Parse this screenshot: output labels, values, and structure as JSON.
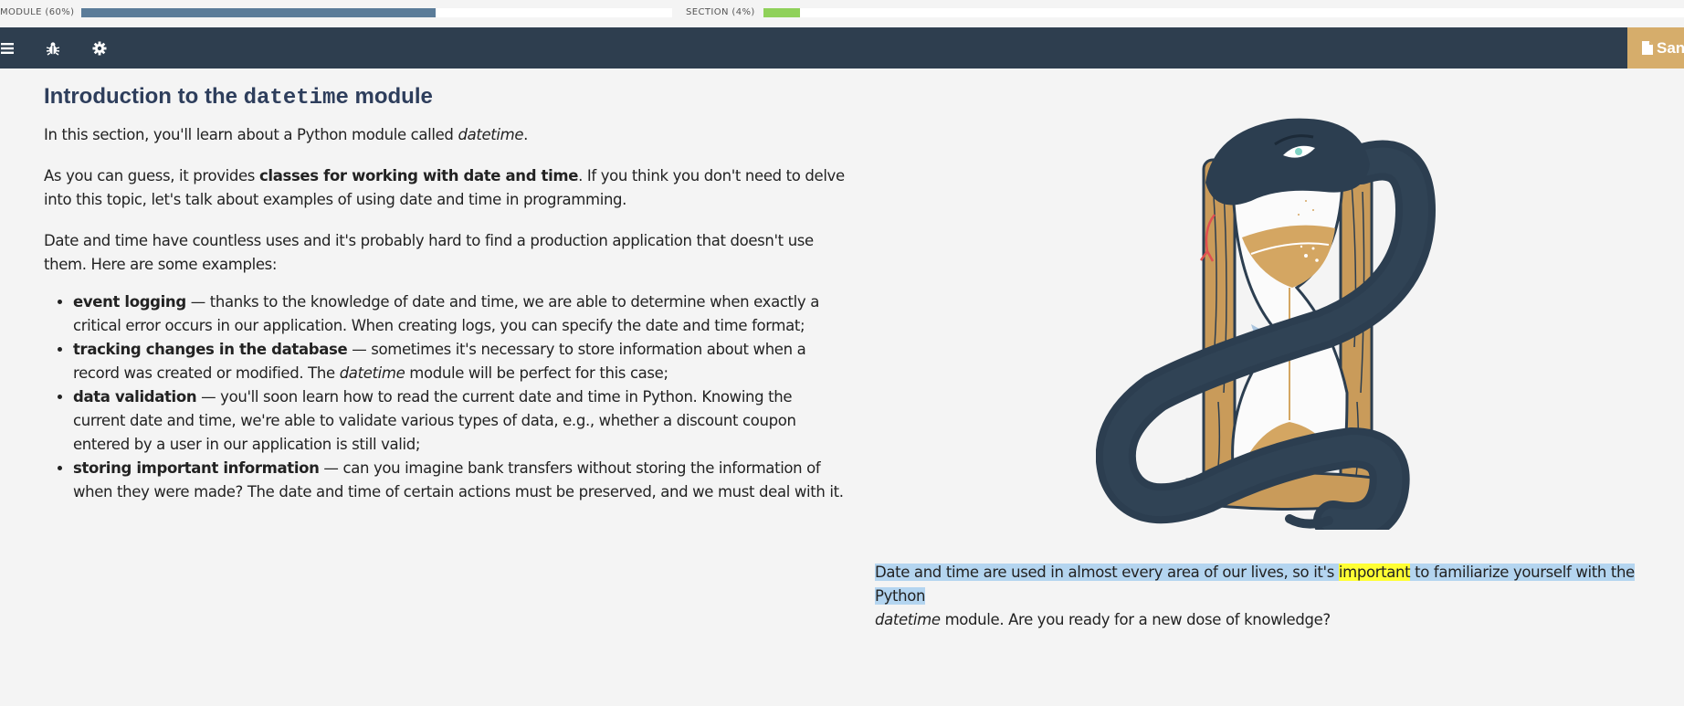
{
  "progress": {
    "module": {
      "label": "MODULE (60%)",
      "value": 0.6,
      "color": "#5b7c99"
    },
    "section": {
      "label": "SECTION (4%)",
      "value": 0.04,
      "color": "#8fd15a"
    }
  },
  "navbar": {
    "icons": [
      "menu-icon",
      "bug-icon",
      "gear-icon"
    ],
    "sandbox_label": "Sandbox",
    "background": "#2e3e4f",
    "sandbox_color": "#d6ad6b"
  },
  "article": {
    "title_pre": "Introduction to the ",
    "title_code": "datetime",
    "title_post": " module",
    "intro_pre": "In this section, you'll learn about a Python module called ",
    "intro_em": "datetime",
    "intro_post": ".",
    "p2_pre": "As you can guess, it provides ",
    "p2_bold": "classes for working with date and time",
    "p2_post": ". If you think you don't need to delve into this topic, let's talk about examples of using date and time in programming.",
    "p3": "Date and time have countless uses and it's probably hard to find a production application that doesn't use them. Here are some examples:",
    "examples": [
      {
        "bold": "event logging",
        "text": " — thanks to the knowledge of date and time, we are able to determine when exactly a critical error occurs in our application. When creating logs, you can specify the date and time format;"
      },
      {
        "bold": "tracking changes in the database",
        "text_pre": " — sometimes it's necessary to store information about when a record was created or modified. The ",
        "em": "datetime",
        "text_post": " module will be perfect for this case;"
      },
      {
        "bold": "data validation",
        "text": " — you'll soon learn how to read the current date and time in Python. Knowing the current date and time, we're able to validate various types of data, e.g., whether a discount coupon entered by a user in our application is still valid;"
      },
      {
        "bold": "storing important information",
        "text": " — can you imagine bank transfers without storing the information of when they were made? The date and time of certain actions must be preserved, and we must deal with it."
      }
    ],
    "closing_pre": "Date and time are used in almost every area of our lives, so it's ",
    "closing_highlight": "important",
    "closing_mid": " to familiarize yourself with the Python",
    "closing_em": "datetime",
    "closing_post": " module. Are you ready for a new dose of knowledge?"
  },
  "illustration": {
    "name": "snake-hourglass-illustration"
  }
}
